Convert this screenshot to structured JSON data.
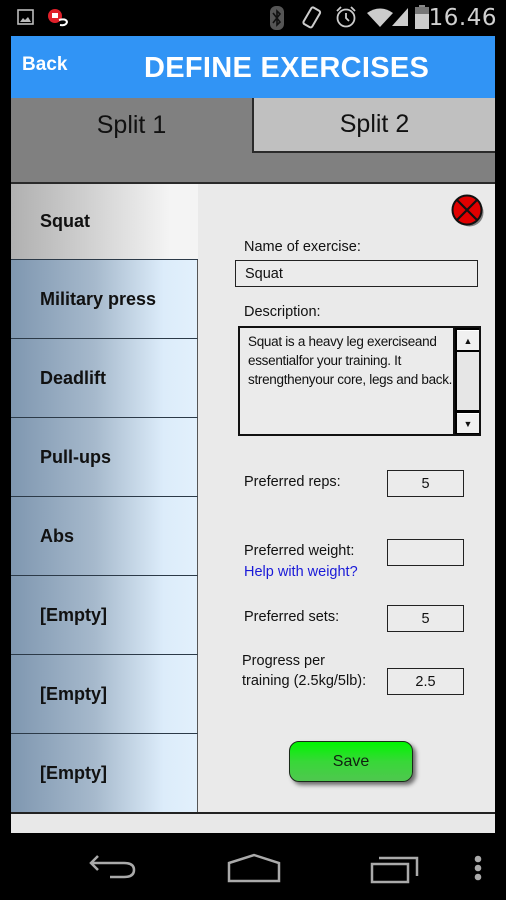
{
  "status_bar": {
    "time": "16.46",
    "icons": [
      "gallery-icon",
      "screen-record-icon",
      "bluetooth-icon",
      "vibrate-icon",
      "alarm-icon",
      "wifi-icon",
      "signal-icon",
      "battery-icon"
    ]
  },
  "header": {
    "back_label": "Back",
    "title": "DEFINE EXERCISES",
    "color": "#3194f5"
  },
  "tabs": [
    {
      "label": "Split 1",
      "selected": true
    },
    {
      "label": "Split 2",
      "selected": false
    }
  ],
  "exercises": [
    {
      "label": "Squat",
      "selected": true
    },
    {
      "label": "Military press",
      "selected": false
    },
    {
      "label": "Deadlift",
      "selected": false
    },
    {
      "label": "Pull-ups",
      "selected": false
    },
    {
      "label": "Abs",
      "selected": false
    },
    {
      "label": "[Empty]",
      "selected": false
    },
    {
      "label": "[Empty]",
      "selected": false
    },
    {
      "label": "[Empty]",
      "selected": false
    }
  ],
  "form": {
    "name_label": "Name of exercise:",
    "name_value": "Squat",
    "description_label": "Description:",
    "description_value": "Squat is a heavy leg exerciseand essentialfor your training. It strengthenyour core, legs and back.",
    "reps_label": "Preferred  reps:",
    "reps_value": "5",
    "weight_label": "Preferred  weight:",
    "weight_value": "",
    "help_link": "Help with weight?",
    "sets_label": "Preferred  sets:",
    "sets_value": "5",
    "progress_label_line1": "Progress per",
    "progress_label_line2": "training (2.5kg/5lb):",
    "progress_value": "2.5",
    "save_label": "Save",
    "save_color": "#22dd22",
    "delete_color": "#e00000"
  },
  "nav_bar": {
    "buttons": [
      "back-icon",
      "home-icon",
      "recents-icon",
      "menu-icon"
    ]
  }
}
